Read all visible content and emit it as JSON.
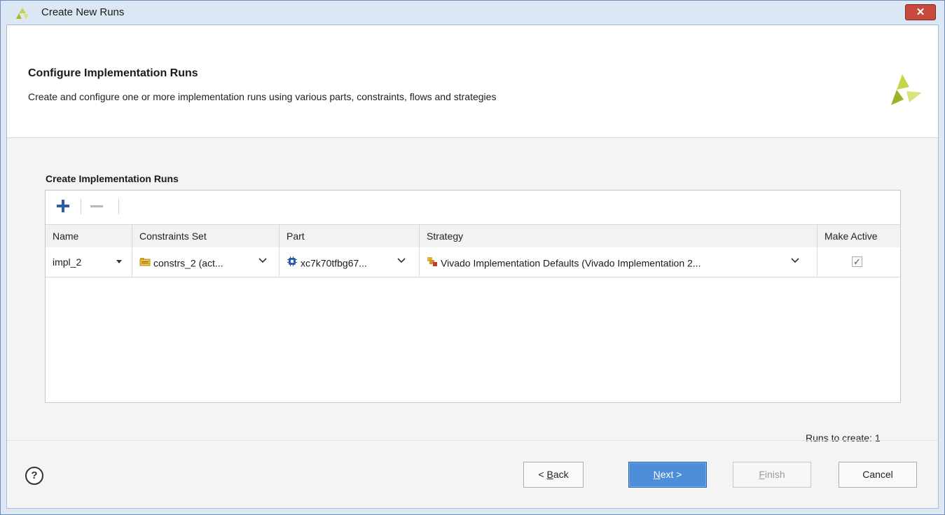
{
  "window": {
    "title": "Create New Runs",
    "close_label": "✕"
  },
  "header": {
    "title": "Configure Implementation Runs",
    "description": "Create and configure one or more implementation runs using various parts, constraints, flows and strategies"
  },
  "section": {
    "label": "Create Implementation Runs"
  },
  "table": {
    "columns": [
      "Name",
      "Constraints Set",
      "Part",
      "Strategy",
      "Make Active"
    ],
    "rows": [
      {
        "name": "impl_2",
        "constraints_set": "constrs_2 (act...",
        "part": "xc7k70tfbg67...",
        "strategy": "Vivado Implementation Defaults (Vivado Implementation 2...",
        "make_active": true,
        "make_active_mark": "✓"
      }
    ]
  },
  "runs_to_create": "Runs to create: 1",
  "buttons": {
    "help": "?",
    "back_prefix": "< ",
    "back_mnemonic": "B",
    "back_rest": "ack",
    "next_mnemonic": "N",
    "next_rest": "ext >",
    "finish_mnemonic": "F",
    "finish_rest": "inish",
    "cancel": "Cancel"
  },
  "colors": {
    "accent": "#4c8fd8",
    "xilinx_logo": "#b5c93a",
    "close": "#c84a3f"
  },
  "icons": {
    "title": "xilinx-logo-icon",
    "add": "plus-icon",
    "remove": "minus-icon",
    "constraints": "folder-icon",
    "part": "chip-icon",
    "strategy": "strategy-icon"
  }
}
